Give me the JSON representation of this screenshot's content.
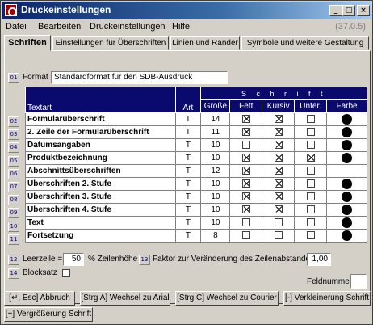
{
  "window": {
    "title": "Druckeinstellungen",
    "version": "(37.0.5)"
  },
  "menu": [
    "Datei",
    "Bearbeiten",
    "Druckeinstellungen",
    "Hilfe"
  ],
  "tabs": [
    "Schriften",
    "Einstellungen für Überschriften",
    "Linien und Ränder",
    "Symbole und weitere Gestaltung"
  ],
  "format": {
    "num": "01",
    "label": "Format",
    "value": "Standardformat für den SDB-Ausdruck"
  },
  "table": {
    "header_group": "S c h r i f t",
    "cols": [
      "Textart",
      "Art",
      "Größe",
      "Fett",
      "Kursiv",
      "Unter.",
      "Farbe"
    ],
    "rows": [
      {
        "num": "02",
        "name": "Formularüberschrift",
        "art": "T",
        "size": "14",
        "bold": true,
        "italic": true,
        "under": false,
        "color": true
      },
      {
        "num": "03",
        "name": "2. Zeile der Formularüberschrift",
        "art": "T",
        "size": "11",
        "bold": true,
        "italic": true,
        "under": false,
        "color": true
      },
      {
        "num": "04",
        "name": "Datumsangaben",
        "art": "T",
        "size": "10",
        "bold": false,
        "italic": true,
        "under": false,
        "color": true
      },
      {
        "num": "05",
        "name": "Produktbezeichnung",
        "art": "T",
        "size": "10",
        "bold": true,
        "italic": true,
        "under": true,
        "color": true
      },
      {
        "num": "06",
        "name": "Abschnittsüberschriften",
        "art": "T",
        "size": "12",
        "bold": true,
        "italic": true,
        "under": false,
        "color": false
      },
      {
        "num": "07",
        "name": "Überschriften 2. Stufe",
        "art": "T",
        "size": "10",
        "bold": true,
        "italic": true,
        "under": false,
        "color": true
      },
      {
        "num": "08",
        "name": "Überschriften 3. Stufe",
        "art": "T",
        "size": "10",
        "bold": true,
        "italic": true,
        "under": false,
        "color": true
      },
      {
        "num": "09",
        "name": "Überschriften 4. Stufe",
        "art": "T",
        "size": "10",
        "bold": true,
        "italic": true,
        "under": false,
        "color": true
      },
      {
        "num": "10",
        "name": "Text",
        "art": "T",
        "size": "10",
        "bold": false,
        "italic": false,
        "under": false,
        "color": true
      },
      {
        "num": "11",
        "name": "Fortsetzung",
        "art": "T",
        "size": "8",
        "bold": false,
        "italic": false,
        "under": false,
        "color": true
      }
    ]
  },
  "leerzeile": {
    "num": "12",
    "label": "Leerzeile =",
    "value": "50",
    "suffix": "% Zeilenhöhe"
  },
  "faktor": {
    "num": "13",
    "label": "Faktor zur Veränderung des Zeilenabstandes",
    "value": "1,00"
  },
  "blocksatz": {
    "num": "14",
    "label": "Blocksatz"
  },
  "feldnummer": {
    "label": "Feldnummer"
  },
  "footer": [
    "[↵, Esc] Abbruch",
    "[Strg A] Wechsel zu Arial",
    "[Strg C] Wechsel zu Courier",
    "[-] Verkleinerung Schrift",
    "[+] Vergrößerung Schrift"
  ]
}
